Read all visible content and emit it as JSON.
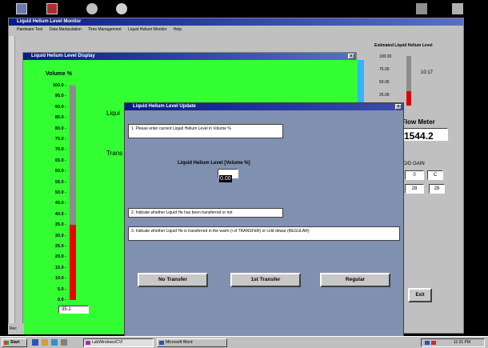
{
  "main_window": {
    "title": "Liquid Helium Level Monitor",
    "menu": [
      "Hardware Test",
      "Data Manipulation",
      "Time Management",
      "Liquid Helium Monitor",
      "Help"
    ]
  },
  "gauge_window": {
    "title": "Liquid Helium Level Display",
    "axis_label": "Volume %",
    "ticks": [
      "100.0",
      "95.0",
      "90.0",
      "85.0",
      "80.0",
      "75.0",
      "70.0",
      "65.0",
      "60.0",
      "55.0",
      "50.0",
      "45.0",
      "40.0",
      "35.0",
      "30.0",
      "25.0",
      "20.0",
      "15.0",
      "10.0",
      "5.0",
      "0.0"
    ],
    "level_percent": 35.1,
    "readout": "35.1",
    "partial_label_1": "Liqui",
    "partial_label_2": "Trans",
    "bg_color": "#33ff33",
    "fill_color": "#ee0000",
    "empty_color": "#8c8c8c"
  },
  "dialog": {
    "title": "Liquid Helium Level Update",
    "instruction_1": "1. Please enter current Liquid Helium Level in Volume %",
    "field_label": "Liquid Helium Level [Volume %]",
    "field_value": "0.00",
    "instruction_2": "2. Indicate whether Liquid He has been transferred or not",
    "instruction_3": "3. Indicate whether Liquid He is transferred in the warm (i of TRANSFER) or cold dewar (REGULAR)",
    "buttons": {
      "no_transfer": "No Transfer",
      "first_transfer": "1st Transfer",
      "regular": "Regular"
    },
    "bg_color": "#8090b0"
  },
  "right_panel": {
    "title": "Estimated Liquid Helium Level",
    "scale_ticks": [
      "100.00",
      "75.00",
      "50.00",
      "25.00"
    ],
    "time": "10:17",
    "flow_label": "Flow Meter",
    "flow_value": "1544.2",
    "gain_label": "D/D GAIN",
    "gain_values": [
      "0",
      "C"
    ],
    "gain_values_2": [
      "28",
      "28"
    ],
    "exit_label": "Exit"
  },
  "taskbar": {
    "start": "Start",
    "tasks": [
      "LabWindows/CVI",
      "Microsoft Word"
    ],
    "clock": "11:31 PM"
  },
  "statusbar": {
    "text": "Rec"
  }
}
